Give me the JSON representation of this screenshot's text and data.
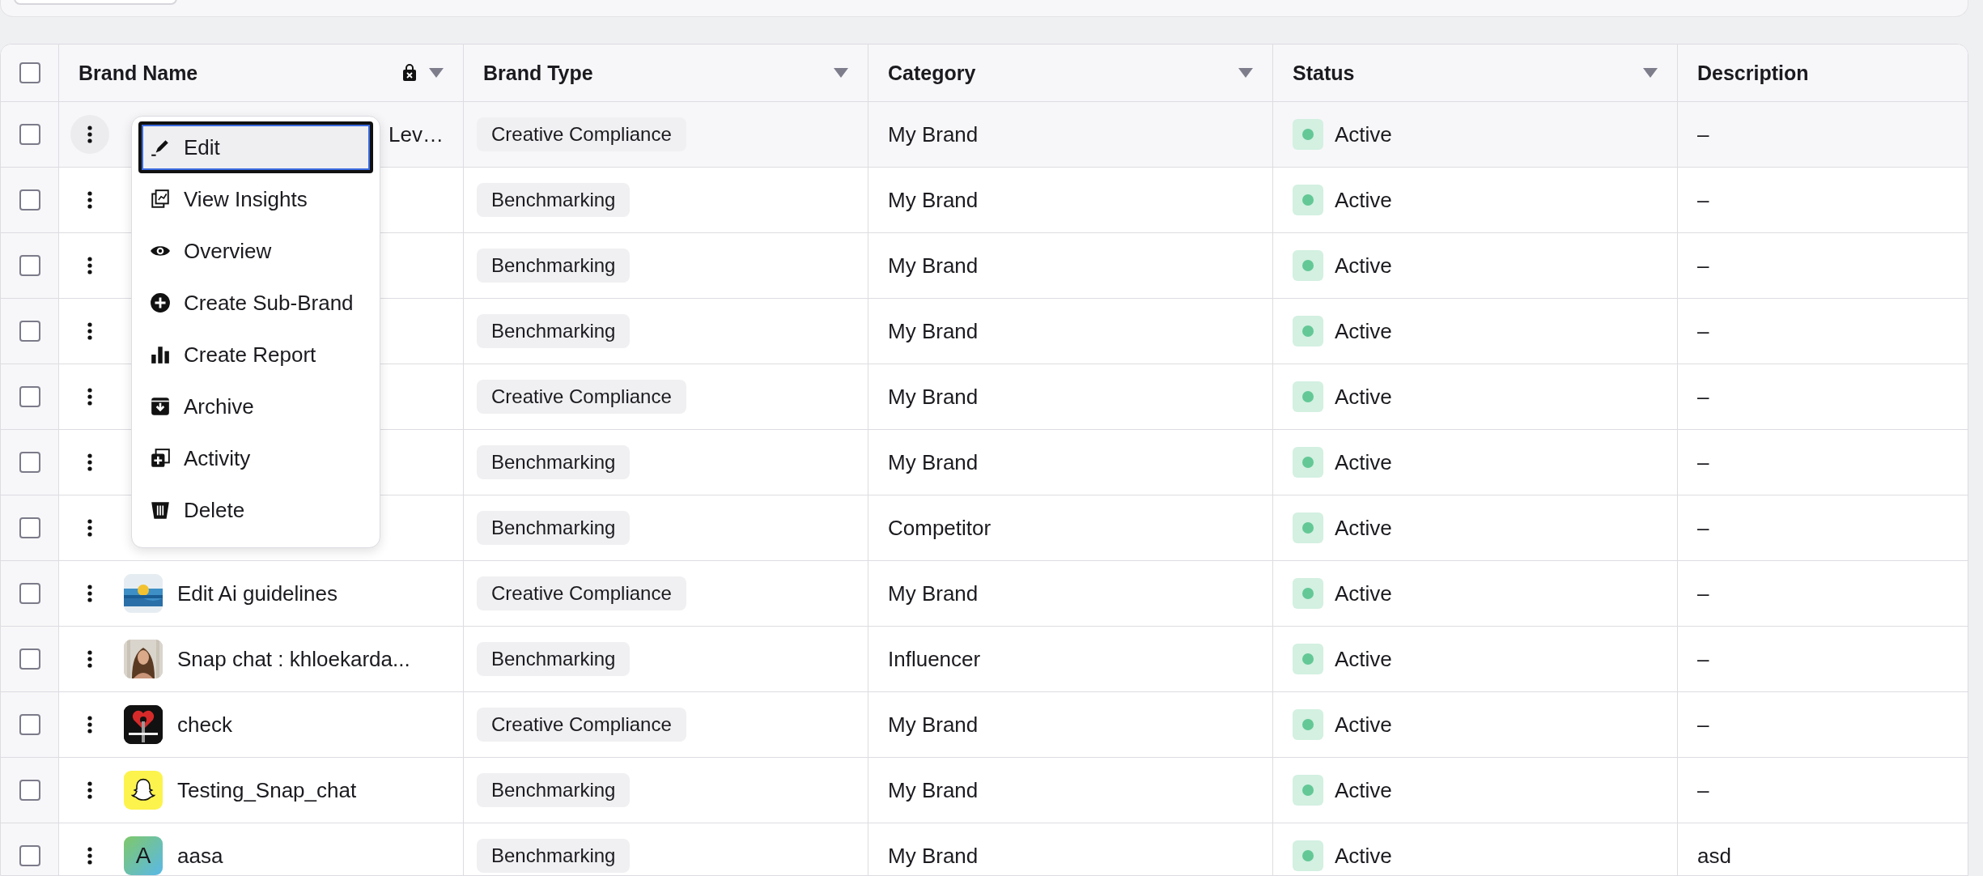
{
  "table": {
    "select_all_checked": false,
    "columns": [
      {
        "label": "Brand Name",
        "locked": true,
        "filter": true
      },
      {
        "label": "Brand Type",
        "locked": false,
        "filter": true
      },
      {
        "label": "Category",
        "locked": false,
        "filter": true
      },
      {
        "label": "Status",
        "locked": false,
        "filter": true
      },
      {
        "label": "Description",
        "locked": false,
        "filter": false
      }
    ],
    "rows": [
      {
        "checked": false,
        "highlighted": true,
        "brand_name": "Lev…",
        "brand_type": "Creative Compliance",
        "category": "My Brand",
        "status": "Active",
        "description": "–"
      },
      {
        "checked": false,
        "highlighted": false,
        "brand_type": "Benchmarking",
        "category": "My Brand",
        "status": "Active",
        "description": "–"
      },
      {
        "checked": false,
        "highlighted": false,
        "brand_type": "Benchmarking",
        "category": "My Brand",
        "status": "Active",
        "description": "–"
      },
      {
        "checked": false,
        "highlighted": false,
        "brand_type": "Benchmarking",
        "category": "My Brand",
        "status": "Active",
        "description": "–"
      },
      {
        "checked": false,
        "highlighted": false,
        "brand_type": "Creative Compliance",
        "category": "My Brand",
        "status": "Active",
        "description": "–"
      },
      {
        "checked": false,
        "highlighted": false,
        "brand_type": "Benchmarking",
        "category": "My Brand",
        "status": "Active",
        "description": "–"
      },
      {
        "checked": false,
        "highlighted": false,
        "brand_type": "Benchmarking",
        "category": "Competitor",
        "status": "Active",
        "description": "–"
      },
      {
        "checked": false,
        "highlighted": false,
        "brand_name": "Edit Ai guidelines",
        "brand_type": "Creative Compliance",
        "category": "My Brand",
        "status": "Active",
        "description": "–"
      },
      {
        "checked": false,
        "highlighted": false,
        "brand_name": "Snap chat : khloekarda...",
        "brand_type": "Benchmarking",
        "category": "Influencer",
        "status": "Active",
        "description": "–"
      },
      {
        "checked": false,
        "highlighted": false,
        "brand_name": "check",
        "brand_type": "Creative Compliance",
        "category": "My Brand",
        "status": "Active",
        "description": "–"
      },
      {
        "checked": false,
        "highlighted": false,
        "avatar": {
          "kind": "ghost"
        },
        "brand_name": "Testing_Snap_chat",
        "brand_type": "Benchmarking",
        "category": "My Brand",
        "status": "Active",
        "description": "–"
      },
      {
        "checked": false,
        "highlighted": false,
        "avatar": {
          "kind": "letter",
          "letter": "A"
        },
        "brand_name": "aasa",
        "brand_type": "Benchmarking",
        "category": "My Brand",
        "status": "Active",
        "description": "asd"
      }
    ]
  },
  "context_menu": {
    "items": [
      {
        "label": "Edit",
        "focused": true
      },
      {
        "label": "View Insights",
        "focused": false
      },
      {
        "label": "Overview",
        "focused": false
      },
      {
        "label": "Create Sub-Brand",
        "focused": false
      },
      {
        "label": "Create Report",
        "focused": false
      },
      {
        "label": "Archive",
        "focused": false
      },
      {
        "label": "Activity",
        "focused": false
      },
      {
        "label": "Delete",
        "focused": false
      }
    ]
  }
}
